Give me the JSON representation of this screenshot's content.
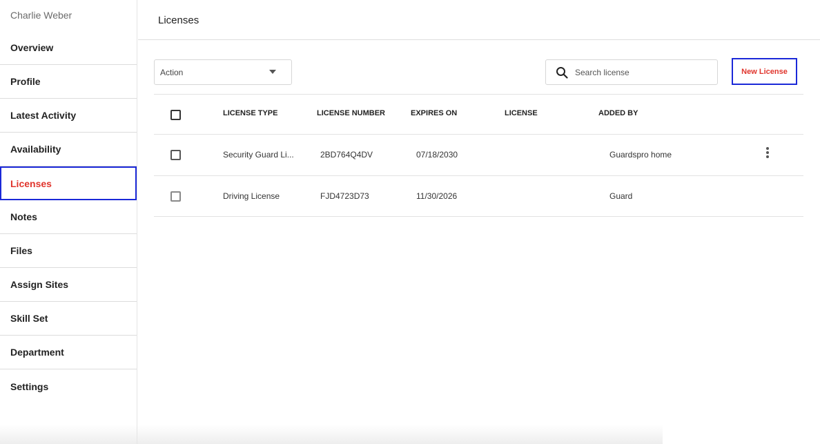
{
  "user": {
    "name": "Charlie Weber"
  },
  "sidebar": {
    "items": [
      {
        "label": "Overview"
      },
      {
        "label": "Profile"
      },
      {
        "label": "Latest Activity"
      },
      {
        "label": "Availability"
      },
      {
        "label": "Licenses",
        "active": true
      },
      {
        "label": "Notes"
      },
      {
        "label": "Files"
      },
      {
        "label": "Assign Sites"
      },
      {
        "label": "Skill Set"
      },
      {
        "label": "Department"
      },
      {
        "label": "Settings"
      }
    ]
  },
  "header": {
    "title": "Licenses"
  },
  "toolbar": {
    "action_label": "Action",
    "search_placeholder": "Search license",
    "search_value": "",
    "new_button_label": "New License"
  },
  "table": {
    "columns": [
      "LICENSE TYPE",
      "LICENSE NUMBER",
      "EXPIRES ON",
      "LICENSE",
      "ADDED BY"
    ],
    "rows": [
      {
        "license_type": "Security Guard Li...",
        "license_number": "2BD764Q4DV",
        "expires_on": "07/18/2030",
        "license": "",
        "added_by": "Guardspro home"
      },
      {
        "license_type": "Driving License",
        "license_number": "FJD4723D73",
        "expires_on": "11/30/2026",
        "license": "",
        "added_by": "Guard"
      }
    ]
  },
  "colors": {
    "accent": "#e0342c",
    "highlight_border": "#1a28d8"
  },
  "icons": {
    "search": "search-icon",
    "dropdown": "chevron-down-icon",
    "row_menu": "more-vertical-icon"
  }
}
